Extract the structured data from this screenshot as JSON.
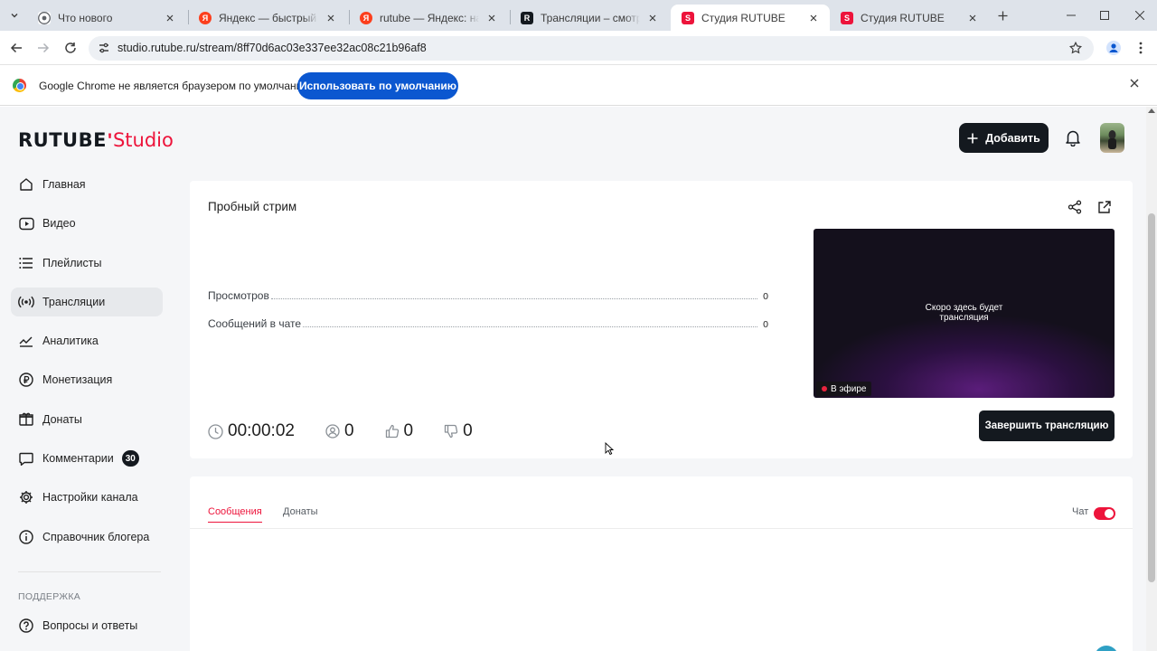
{
  "browser": {
    "tabs": [
      {
        "title": "Что нового",
        "favicon": "chrome-icon",
        "active": false
      },
      {
        "title": "Яндекс — быстрый поиск",
        "favicon": "yandex-icon",
        "active": false
      },
      {
        "title": "rutube — Яндекс: нашлось",
        "favicon": "yandex-icon",
        "active": false
      },
      {
        "title": "Трансляции – смотреть в",
        "favicon": "rutube-icon",
        "active": false
      },
      {
        "title": "Студия RUTUBE",
        "favicon": "rutube-studio-icon",
        "active": true
      },
      {
        "title": "Студия RUTUBE",
        "favicon": "rutube-studio-icon",
        "active": false
      }
    ],
    "url": "studio.rutube.ru/stream/8ff70d6ac03e337ee32ac08c21b96af8",
    "infobar": {
      "message": "Google Chrome не является браузером по умолчанию.",
      "button": "Использовать по умолчанию"
    }
  },
  "header": {
    "logo_main": "RUTUBE",
    "logo_sub": "Studio",
    "add_button": "Добавить"
  },
  "sidebar": {
    "items": [
      {
        "label": "Главная",
        "icon": "home-icon"
      },
      {
        "label": "Видео",
        "icon": "video-icon"
      },
      {
        "label": "Плейлисты",
        "icon": "playlist-icon"
      },
      {
        "label": "Трансляции",
        "icon": "broadcast-icon",
        "active": true
      },
      {
        "label": "Аналитика",
        "icon": "analytics-icon"
      },
      {
        "label": "Монетизация",
        "icon": "ruble-icon"
      },
      {
        "label": "Донаты",
        "icon": "donate-icon"
      },
      {
        "label": "Комментарии",
        "icon": "comment-icon",
        "badge": "30"
      },
      {
        "label": "Настройки канала",
        "icon": "gear-icon"
      },
      {
        "label": "Справочник блогера",
        "icon": "info-icon"
      }
    ],
    "support_title": "ПОДДЕРЖКА",
    "faq": "Вопросы и ответы"
  },
  "stream": {
    "title": "Пробный стрим",
    "stats": [
      {
        "label": "Просмотров",
        "value": "0"
      },
      {
        "label": "Сообщений в чате",
        "value": "0"
      }
    ],
    "preview_text_1": "Скоро здесь будет",
    "preview_text_2": "трансляция",
    "live_label": "В эфире",
    "duration": "00:00:02",
    "viewers": "0",
    "likes": "0",
    "dislikes": "0",
    "end_button": "Завершить трансляцию"
  },
  "chat": {
    "tab_messages": "Сообщения",
    "tab_donations": "Донаты",
    "chat_label": "Чат",
    "chat_enabled": true
  },
  "colors": {
    "accent": "#ed143b",
    "dark": "#14191f",
    "chrome_blue": "#0b57d0"
  }
}
